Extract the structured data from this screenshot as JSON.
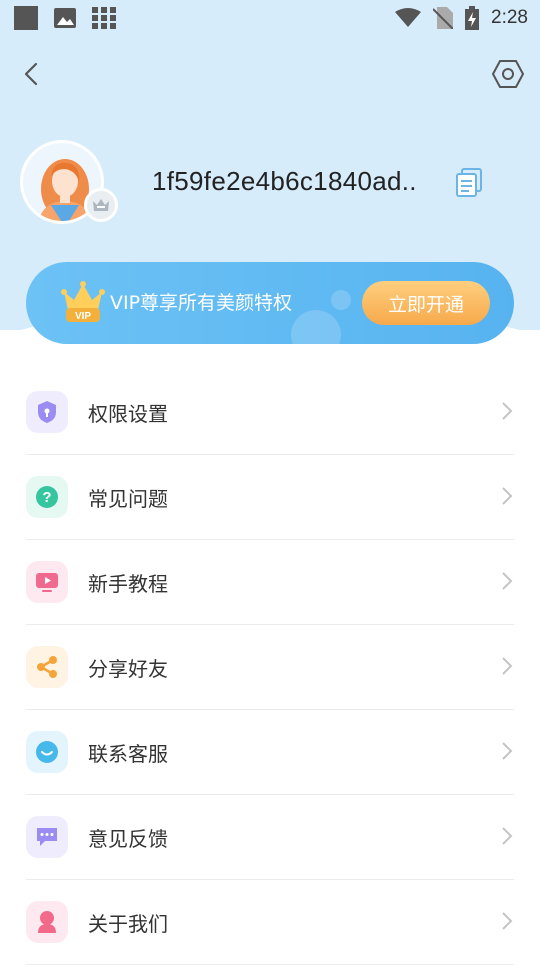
{
  "status_bar": {
    "time": "2:28"
  },
  "header": {
    "username": "1f59fe2e4b6c1840ad.."
  },
  "vip": {
    "text": "VIP尊享所有美颜特权",
    "button": "立即开通",
    "crown_label": "VIP"
  },
  "menu": {
    "items": [
      {
        "label": "权限设置",
        "icon": "shield-icon",
        "color": "#9a8cf2",
        "bg": "#efedfd"
      },
      {
        "label": "常见问题",
        "icon": "question-icon",
        "color": "#35c6a0",
        "bg": "#e6f8f2"
      },
      {
        "label": "新手教程",
        "icon": "video-icon",
        "color": "#f06a8f",
        "bg": "#fde9ef"
      },
      {
        "label": "分享好友",
        "icon": "share-icon",
        "color": "#f6a43a",
        "bg": "#fff3e3"
      },
      {
        "label": "联系客服",
        "icon": "chat-face-icon",
        "color": "#47b8ea",
        "bg": "#e4f4fc"
      },
      {
        "label": "意见反馈",
        "icon": "message-icon",
        "color": "#9a8cf2",
        "bg": "#efedfd"
      },
      {
        "label": "关于我们",
        "icon": "person-icon",
        "color": "#f26a8a",
        "bg": "#fde9ef"
      }
    ]
  }
}
